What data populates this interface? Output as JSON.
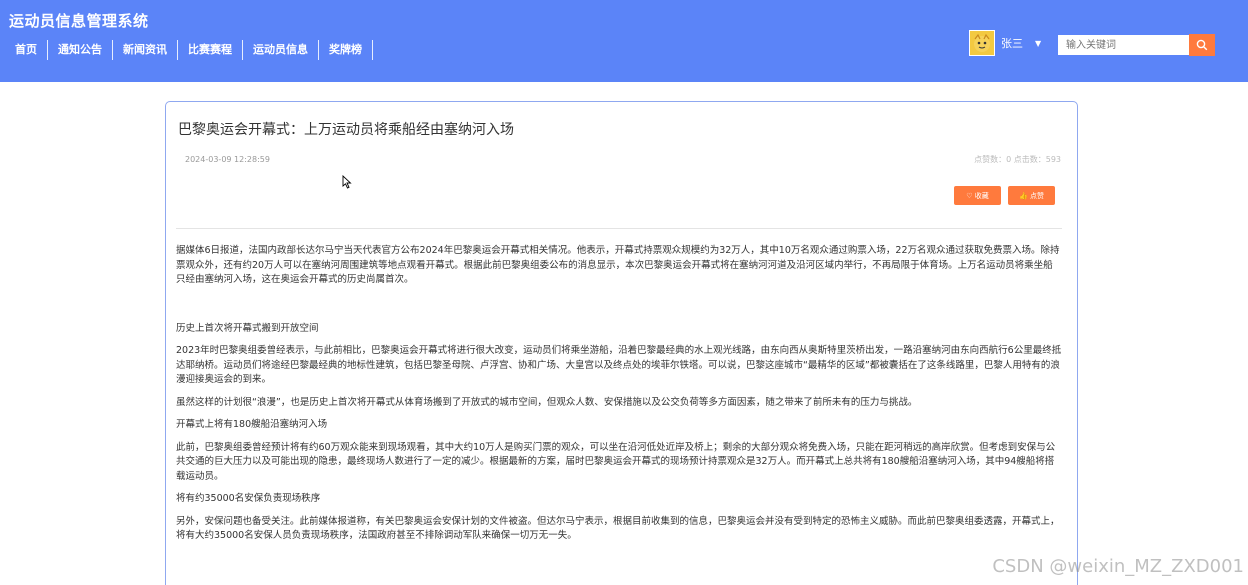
{
  "header": {
    "site_title": "运动员信息管理系统",
    "nav": [
      "首页",
      "通知公告",
      "新闻资讯",
      "比赛赛程",
      "运动员信息",
      "奖牌榜"
    ],
    "user": {
      "name": "张三",
      "avatar_icon": "avatar-icon"
    },
    "search": {
      "placeholder": "输入关键词",
      "icon": "search-icon"
    }
  },
  "article": {
    "title": "巴黎奥运会开幕式：上万运动员将乘船经由塞纳河入场",
    "time": "2024-03-09 12:28:59",
    "stats": "点赞数：0  点击数：593",
    "fav_label": "♡ 收藏",
    "like_label": "👍 点赞",
    "paragraphs": [
      "据媒体6日报道，法国内政部长达尔马宁当天代表官方公布2024年巴黎奥运会开幕式相关情况。他表示，开幕式持票观众规模约为32万人，其中10万名观众通过购票入场，22万名观众通过获取免费票入场。除持票观众外，还有约20万人可以在塞纳河周围建筑等地点观看开幕式。根据此前巴黎奥组委公布的消息显示，本次巴黎奥运会开幕式将在塞纳河河道及沿河区域内举行，不再局限于体育场。上万名运动员将乘坐船只经由塞纳河入场，这在奥运会开幕式的历史尚属首次。",
      "历史上首次将开幕式搬到开放空间",
      "2023年时巴黎奥组委曾经表示，与此前相比，巴黎奥运会开幕式将进行很大改变，运动员们将乘坐游船，沿着巴黎最经典的水上观光线路，由东向西从奥斯特里茨桥出发，一路沿塞纳河由东向西航行6公里最终抵达耶纳桥。运动员们将途经巴黎最经典的地标性建筑，包括巴黎圣母院、卢浮宫、协和广场、大皇宫以及终点处的埃菲尔铁塔。可以说，巴黎这座城市“最精华的区域”都被囊括在了这条线路里，巴黎人用特有的浪漫迎接奥运会的到来。",
      "虽然这样的计划很“浪漫”，也是历史上首次将开幕式从体育场搬到了开放式的城市空间，但观众人数、安保措施以及公交负荷等多方面因素，随之带来了前所未有的压力与挑战。",
      "开幕式上将有180艘船沿塞纳河入场",
      "此前，巴黎奥组委曾经预计将有约60万观众能来到现场观看，其中大约10万人是购买门票的观众，可以坐在沿河低处近岸及桥上；剩余的大部分观众将免费入场，只能在距河稍远的高岸欣赏。但考虑到安保与公共交通的巨大压力以及可能出现的隐患，最终现场人数进行了一定的减少。根据最新的方案，届时巴黎奥运会开幕式的现场预计持票观众是32万人。而开幕式上总共将有180艘船沿塞纳河入场，其中94艘船将搭载运动员。",
      "将有约35000名安保负责现场秩序",
      "另外，安保问题也备受关注。此前媒体报道称，有关巴黎奥运会安保计划的文件被盗。但达尔马宁表示，根据目前收集到的信息，巴黎奥运会并没有受到特定的恐怖主义威胁。而此前巴黎奥组委透露，开幕式上，将有大约35000名安保人员负责现场秩序，法国政府甚至不排除调动军队来确保一切万无一失。"
    ]
  },
  "watermark": "CSDN @weixin_MZ_ZXD001",
  "colors": {
    "header_bg": "#5b84f8",
    "accent": "#ff7a3d",
    "card_border": "#8fa8f0"
  }
}
